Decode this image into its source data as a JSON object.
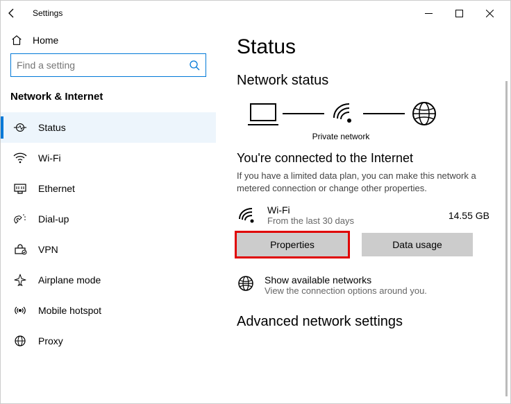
{
  "window": {
    "title": "Settings"
  },
  "sidebar": {
    "home": "Home",
    "search_placeholder": "Find a setting",
    "section": "Network & Internet",
    "items": [
      {
        "label": "Status"
      },
      {
        "label": "Wi-Fi"
      },
      {
        "label": "Ethernet"
      },
      {
        "label": "Dial-up"
      },
      {
        "label": "VPN"
      },
      {
        "label": "Airplane mode"
      },
      {
        "label": "Mobile hotspot"
      },
      {
        "label": "Proxy"
      }
    ]
  },
  "main": {
    "title": "Status",
    "network_status": "Network status",
    "private_network": "Private network",
    "connected_heading": "You're connected to the Internet",
    "connected_desc": "If you have a limited data plan, you can make this network a metered connection or change other properties.",
    "connection": {
      "name": "Wi-Fi",
      "sub": "From the last 30 days",
      "usage": "14.55 GB"
    },
    "buttons": {
      "properties": "Properties",
      "data_usage": "Data usage"
    },
    "available": {
      "title": "Show available networks",
      "sub": "View the connection options around you."
    },
    "advanced": "Advanced network settings"
  }
}
